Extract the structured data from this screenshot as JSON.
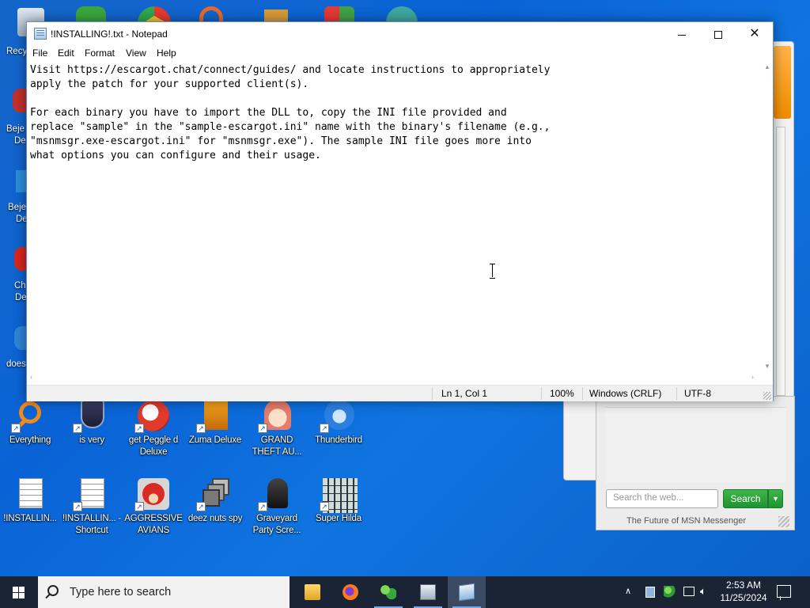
{
  "notepad": {
    "title": "!INSTALLING!.txt - Notepad",
    "menu": [
      "File",
      "Edit",
      "Format",
      "View",
      "Help"
    ],
    "content": "Visit https://escargot.chat/connect/guides/ and locate instructions to appropriately\napply the patch for your supported client(s).\n\nFor each binary you have to import the DLL to, copy the INI file provided and\nreplace \"sample\" in the \"sample-escargot.ini\" name with the binary's filename (e.g.,\n\"msnmsgr.exe-escargot.ini\" for \"msnmsgr.exe\"). The sample INI file goes more into\nwhat options you can configure and their usage.",
    "status": {
      "position": "Ln 1, Col 1",
      "zoom": "100%",
      "line_ending": "Windows (CRLF)",
      "encoding": "UTF-8"
    }
  },
  "msn": {
    "search_placeholder": "Search the web...",
    "search_button": "Search",
    "footer": "The Future of MSN Messenger"
  },
  "desktop": {
    "partial_labels": [
      "Recy",
      "Beje",
      "De",
      "Beje",
      "De",
      "Ch",
      "De",
      "does"
    ],
    "row1": [
      {
        "label": "Everything",
        "icon": "everything-icon"
      },
      {
        "label": "is very",
        "icon": "shield-logo-icon"
      },
      {
        "label": "get Peggle d Deluxe",
        "icon": "peggle-icon"
      },
      {
        "label": "Zuma Deluxe",
        "icon": "zuma-icon"
      },
      {
        "label": "GRAND THEFT AU...",
        "icon": "anime-girl-icon"
      },
      {
        "label": "Thunderbird",
        "icon": "thunderbird-icon"
      }
    ],
    "row2": [
      {
        "label": "!INSTALLIN...",
        "icon": "text-file-icon"
      },
      {
        "label": "!INSTALLIN... - Shortcut",
        "icon": "text-file-icon"
      },
      {
        "label": "AGGRESSIVE AVIANS",
        "icon": "angry-bird-icon"
      },
      {
        "label": "deez nuts spy",
        "icon": "windows-stack-icon"
      },
      {
        "label": "Graveyard Party Scre...",
        "icon": "graveyard-icon"
      },
      {
        "label": "Super Hilda",
        "icon": "pixel-cat-icon"
      }
    ]
  },
  "taskbar": {
    "search_placeholder": "Type here to search",
    "time": "2:53 AM",
    "date": "11/25/2024"
  }
}
